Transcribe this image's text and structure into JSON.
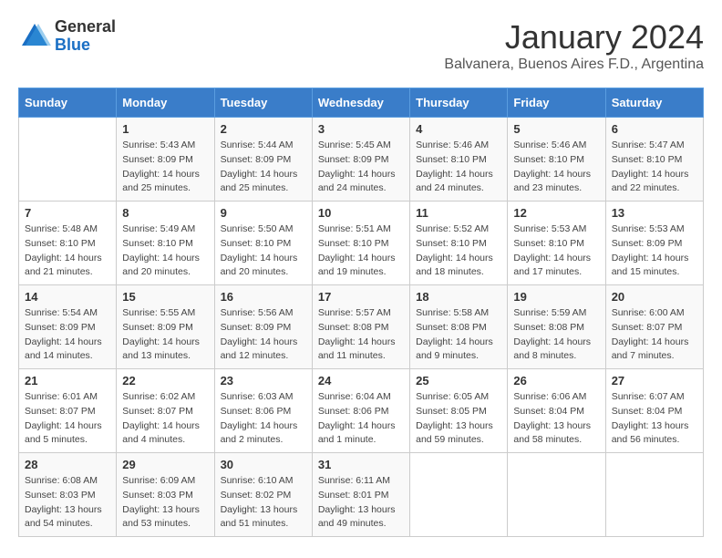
{
  "logo": {
    "general": "General",
    "blue": "Blue"
  },
  "title": "January 2024",
  "subtitle": "Balvanera, Buenos Aires F.D., Argentina",
  "days_header": [
    "Sunday",
    "Monday",
    "Tuesday",
    "Wednesday",
    "Thursday",
    "Friday",
    "Saturday"
  ],
  "weeks": [
    [
      {
        "day": "",
        "info": ""
      },
      {
        "day": "1",
        "info": "Sunrise: 5:43 AM\nSunset: 8:09 PM\nDaylight: 14 hours\nand 25 minutes."
      },
      {
        "day": "2",
        "info": "Sunrise: 5:44 AM\nSunset: 8:09 PM\nDaylight: 14 hours\nand 25 minutes."
      },
      {
        "day": "3",
        "info": "Sunrise: 5:45 AM\nSunset: 8:09 PM\nDaylight: 14 hours\nand 24 minutes."
      },
      {
        "day": "4",
        "info": "Sunrise: 5:46 AM\nSunset: 8:10 PM\nDaylight: 14 hours\nand 24 minutes."
      },
      {
        "day": "5",
        "info": "Sunrise: 5:46 AM\nSunset: 8:10 PM\nDaylight: 14 hours\nand 23 minutes."
      },
      {
        "day": "6",
        "info": "Sunrise: 5:47 AM\nSunset: 8:10 PM\nDaylight: 14 hours\nand 22 minutes."
      }
    ],
    [
      {
        "day": "7",
        "info": "Sunrise: 5:48 AM\nSunset: 8:10 PM\nDaylight: 14 hours\nand 21 minutes."
      },
      {
        "day": "8",
        "info": "Sunrise: 5:49 AM\nSunset: 8:10 PM\nDaylight: 14 hours\nand 20 minutes."
      },
      {
        "day": "9",
        "info": "Sunrise: 5:50 AM\nSunset: 8:10 PM\nDaylight: 14 hours\nand 20 minutes."
      },
      {
        "day": "10",
        "info": "Sunrise: 5:51 AM\nSunset: 8:10 PM\nDaylight: 14 hours\nand 19 minutes."
      },
      {
        "day": "11",
        "info": "Sunrise: 5:52 AM\nSunset: 8:10 PM\nDaylight: 14 hours\nand 18 minutes."
      },
      {
        "day": "12",
        "info": "Sunrise: 5:53 AM\nSunset: 8:10 PM\nDaylight: 14 hours\nand 17 minutes."
      },
      {
        "day": "13",
        "info": "Sunrise: 5:53 AM\nSunset: 8:09 PM\nDaylight: 14 hours\nand 15 minutes."
      }
    ],
    [
      {
        "day": "14",
        "info": "Sunrise: 5:54 AM\nSunset: 8:09 PM\nDaylight: 14 hours\nand 14 minutes."
      },
      {
        "day": "15",
        "info": "Sunrise: 5:55 AM\nSunset: 8:09 PM\nDaylight: 14 hours\nand 13 minutes."
      },
      {
        "day": "16",
        "info": "Sunrise: 5:56 AM\nSunset: 8:09 PM\nDaylight: 14 hours\nand 12 minutes."
      },
      {
        "day": "17",
        "info": "Sunrise: 5:57 AM\nSunset: 8:08 PM\nDaylight: 14 hours\nand 11 minutes."
      },
      {
        "day": "18",
        "info": "Sunrise: 5:58 AM\nSunset: 8:08 PM\nDaylight: 14 hours\nand 9 minutes."
      },
      {
        "day": "19",
        "info": "Sunrise: 5:59 AM\nSunset: 8:08 PM\nDaylight: 14 hours\nand 8 minutes."
      },
      {
        "day": "20",
        "info": "Sunrise: 6:00 AM\nSunset: 8:07 PM\nDaylight: 14 hours\nand 7 minutes."
      }
    ],
    [
      {
        "day": "21",
        "info": "Sunrise: 6:01 AM\nSunset: 8:07 PM\nDaylight: 14 hours\nand 5 minutes."
      },
      {
        "day": "22",
        "info": "Sunrise: 6:02 AM\nSunset: 8:07 PM\nDaylight: 14 hours\nand 4 minutes."
      },
      {
        "day": "23",
        "info": "Sunrise: 6:03 AM\nSunset: 8:06 PM\nDaylight: 14 hours\nand 2 minutes."
      },
      {
        "day": "24",
        "info": "Sunrise: 6:04 AM\nSunset: 8:06 PM\nDaylight: 14 hours\nand 1 minute."
      },
      {
        "day": "25",
        "info": "Sunrise: 6:05 AM\nSunset: 8:05 PM\nDaylight: 13 hours\nand 59 minutes."
      },
      {
        "day": "26",
        "info": "Sunrise: 6:06 AM\nSunset: 8:04 PM\nDaylight: 13 hours\nand 58 minutes."
      },
      {
        "day": "27",
        "info": "Sunrise: 6:07 AM\nSunset: 8:04 PM\nDaylight: 13 hours\nand 56 minutes."
      }
    ],
    [
      {
        "day": "28",
        "info": "Sunrise: 6:08 AM\nSunset: 8:03 PM\nDaylight: 13 hours\nand 54 minutes."
      },
      {
        "day": "29",
        "info": "Sunrise: 6:09 AM\nSunset: 8:03 PM\nDaylight: 13 hours\nand 53 minutes."
      },
      {
        "day": "30",
        "info": "Sunrise: 6:10 AM\nSunset: 8:02 PM\nDaylight: 13 hours\nand 51 minutes."
      },
      {
        "day": "31",
        "info": "Sunrise: 6:11 AM\nSunset: 8:01 PM\nDaylight: 13 hours\nand 49 minutes."
      },
      {
        "day": "",
        "info": ""
      },
      {
        "day": "",
        "info": ""
      },
      {
        "day": "",
        "info": ""
      }
    ]
  ]
}
